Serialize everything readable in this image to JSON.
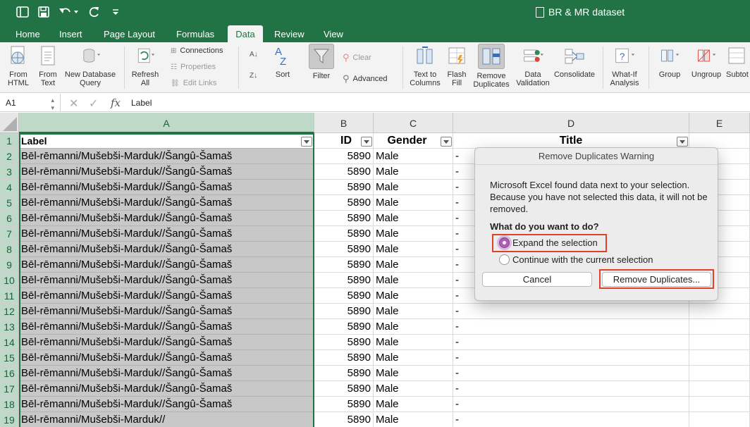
{
  "window": {
    "title": "BR & MR dataset"
  },
  "tabs": [
    "Home",
    "Insert",
    "Page Layout",
    "Formulas",
    "Data",
    "Review",
    "View"
  ],
  "active_tab": "Data",
  "ribbon": {
    "from_html": [
      "From",
      "HTML"
    ],
    "from_text": [
      "From",
      "Text"
    ],
    "new_db_query": [
      "New Database",
      "Query"
    ],
    "refresh_all": [
      "Refresh",
      "All"
    ],
    "connections": "Connections",
    "properties": "Properties",
    "edit_links": "Edit Links",
    "sort": "Sort",
    "filter": "Filter",
    "clear": "Clear",
    "advanced": "Advanced",
    "text_to_columns": [
      "Text to",
      "Columns"
    ],
    "flash_fill": [
      "Flash",
      "Fill"
    ],
    "remove_duplicates": [
      "Remove",
      "Duplicates"
    ],
    "data_validation": [
      "Data",
      "Validation"
    ],
    "consolidate": "Consolidate",
    "what_if": [
      "What-If",
      "Analysis"
    ],
    "group": "Group",
    "ungroup": "Ungroup",
    "subtotal": "Subtot"
  },
  "formula_bar": {
    "name_box": "A1",
    "fx": "fx",
    "content": "Label"
  },
  "columns": [
    "A",
    "B",
    "C",
    "D",
    "E"
  ],
  "header_row": {
    "a": "Label",
    "b": "ID",
    "c": "Gender",
    "d": "Title"
  },
  "rows": [
    {
      "n": "2",
      "a": "Bēl-rēmanni/Mušebši-Marduk//Šangû-Šamaš",
      "b": "5890",
      "c": "Male",
      "d": "-"
    },
    {
      "n": "3",
      "a": "Bēl-rēmanni/Mušebši-Marduk//Šangû-Šamaš",
      "b": "5890",
      "c": "Male",
      "d": "-"
    },
    {
      "n": "4",
      "a": "Bēl-rēmanni/Mušebši-Marduk//Šangû-Šamaš",
      "b": "5890",
      "c": "Male",
      "d": "-"
    },
    {
      "n": "5",
      "a": "Bēl-rēmanni/Mušebši-Marduk//Šangû-Šamaš",
      "b": "5890",
      "c": "Male",
      "d": "-"
    },
    {
      "n": "6",
      "a": "Bēl-rēmanni/Mušebši-Marduk//Šangû-Šamaš",
      "b": "5890",
      "c": "Male",
      "d": "-"
    },
    {
      "n": "7",
      "a": "Bēl-rēmanni/Mušebši-Marduk//Šangû-Šamaš",
      "b": "5890",
      "c": "Male",
      "d": "-"
    },
    {
      "n": "8",
      "a": "Bēl-rēmanni/Mušebši-Marduk//Šangû-Šamaš",
      "b": "5890",
      "c": "Male",
      "d": "-"
    },
    {
      "n": "9",
      "a": "Bēl-rēmanni/Mušebši-Marduk//Šangû-Šamaš",
      "b": "5890",
      "c": "Male",
      "d": "-"
    },
    {
      "n": "10",
      "a": "Bēl-rēmanni/Mušebši-Marduk//Šangû-Šamaš",
      "b": "5890",
      "c": "Male",
      "d": "-"
    },
    {
      "n": "11",
      "a": "Bēl-rēmanni/Mušebši-Marduk//Šangû-Šamaš",
      "b": "5890",
      "c": "Male",
      "d": "-"
    },
    {
      "n": "12",
      "a": "Bēl-rēmanni/Mušebši-Marduk//Šangû-Šamaš",
      "b": "5890",
      "c": "Male",
      "d": "-"
    },
    {
      "n": "13",
      "a": "Bēl-rēmanni/Mušebši-Marduk//Šangû-Šamaš",
      "b": "5890",
      "c": "Male",
      "d": "-"
    },
    {
      "n": "14",
      "a": "Bēl-rēmanni/Mušebši-Marduk//Šangû-Šamaš",
      "b": "5890",
      "c": "Male",
      "d": "-"
    },
    {
      "n": "15",
      "a": "Bēl-rēmanni/Mušebši-Marduk//Šangû-Šamaš",
      "b": "5890",
      "c": "Male",
      "d": "-"
    },
    {
      "n": "16",
      "a": "Bēl-rēmanni/Mušebši-Marduk//Šangû-Šamaš",
      "b": "5890",
      "c": "Male",
      "d": "-"
    },
    {
      "n": "17",
      "a": "Bēl-rēmanni/Mušebši-Marduk//Šangû-Šamaš",
      "b": "5890",
      "c": "Male",
      "d": "-"
    },
    {
      "n": "18",
      "a": "Bēl-rēmanni/Mušebši-Marduk//Šangû-Šamaš",
      "b": "5890",
      "c": "Male",
      "d": "-"
    },
    {
      "n": "19",
      "a": "Bēl-rēmanni/Mušebši-Marduk//",
      "b": "5890",
      "c": "Male",
      "d": "-"
    }
  ],
  "dialog": {
    "title": "Remove Duplicates Warning",
    "message": "Microsoft Excel found data next to your selection. Because you have not selected this data, it will not be removed.",
    "question": "What do you want to do?",
    "option_expand": "Expand the selection",
    "option_current": "Continue with the current selection",
    "cancel": "Cancel",
    "remove": "Remove Duplicates...",
    "selected_option": "expand"
  },
  "colors": {
    "excel_green": "#217346",
    "highlight": "#e0412b",
    "radio_on": "#b25bb7"
  }
}
